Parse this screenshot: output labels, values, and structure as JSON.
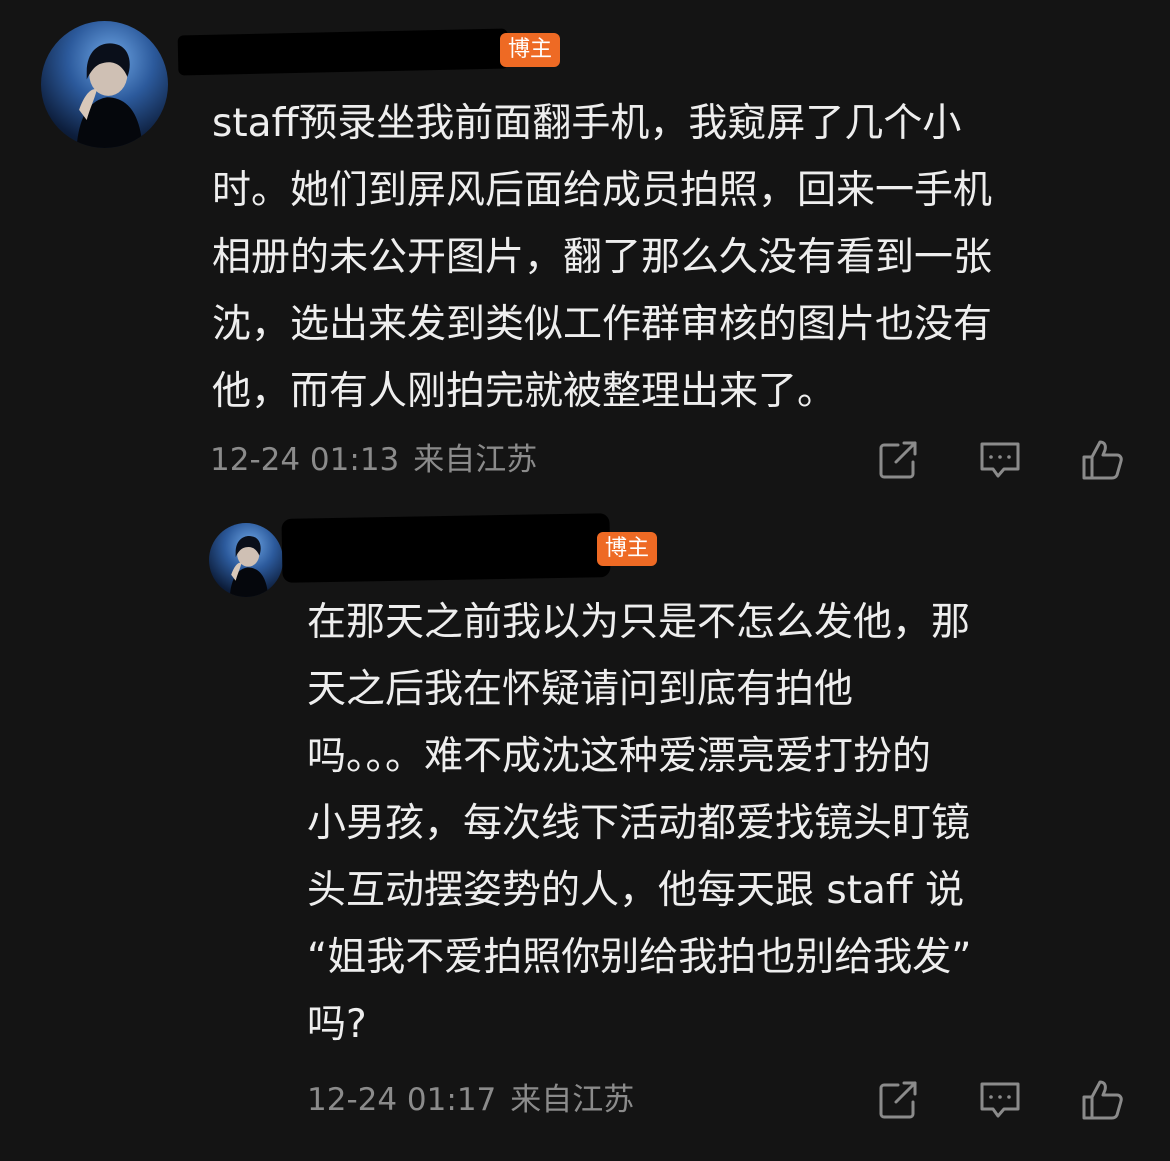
{
  "comments": [
    {
      "badge": "博主",
      "lines": [
        "staff预录坐我前面翻手机，我窥屏了几个小",
        "时。她们到屏风后面给成员拍照，回来一手机",
        "相册的未公开图片，翻了那么久没有看到一张",
        "沈，选出来发到类似工作群审核的图片也没有",
        "他，而有人刚拍完就被整理出来了。"
      ],
      "time": "12-24 01:13",
      "location": "来自江苏",
      "icons": [
        "share-icon",
        "comment-icon",
        "like-icon"
      ]
    },
    {
      "badge": "博主",
      "lines": [
        "在那天之前我以为只是不怎么发他，那",
        "天之后我在怀疑请问到底有拍他",
        "吗。。。难不成沈这种爱漂亮爱打扮的",
        "小男孩，每次线下活动都爱找镜头盯镜",
        "头互动摆姿势的人，他每天跟 staff 说",
        "“姐我不爱拍照你别给我拍也别给我发”",
        "吗?"
      ],
      "time": "12-24 01:17",
      "location": "来自江苏",
      "icons": [
        "share-icon",
        "comment-icon",
        "like-icon"
      ]
    }
  ],
  "colors": {
    "background": "#141414",
    "text": "#eeeeee",
    "meta": "#8b8b8b",
    "badge": "#ee6a24",
    "icon": "#8b8b8b"
  }
}
